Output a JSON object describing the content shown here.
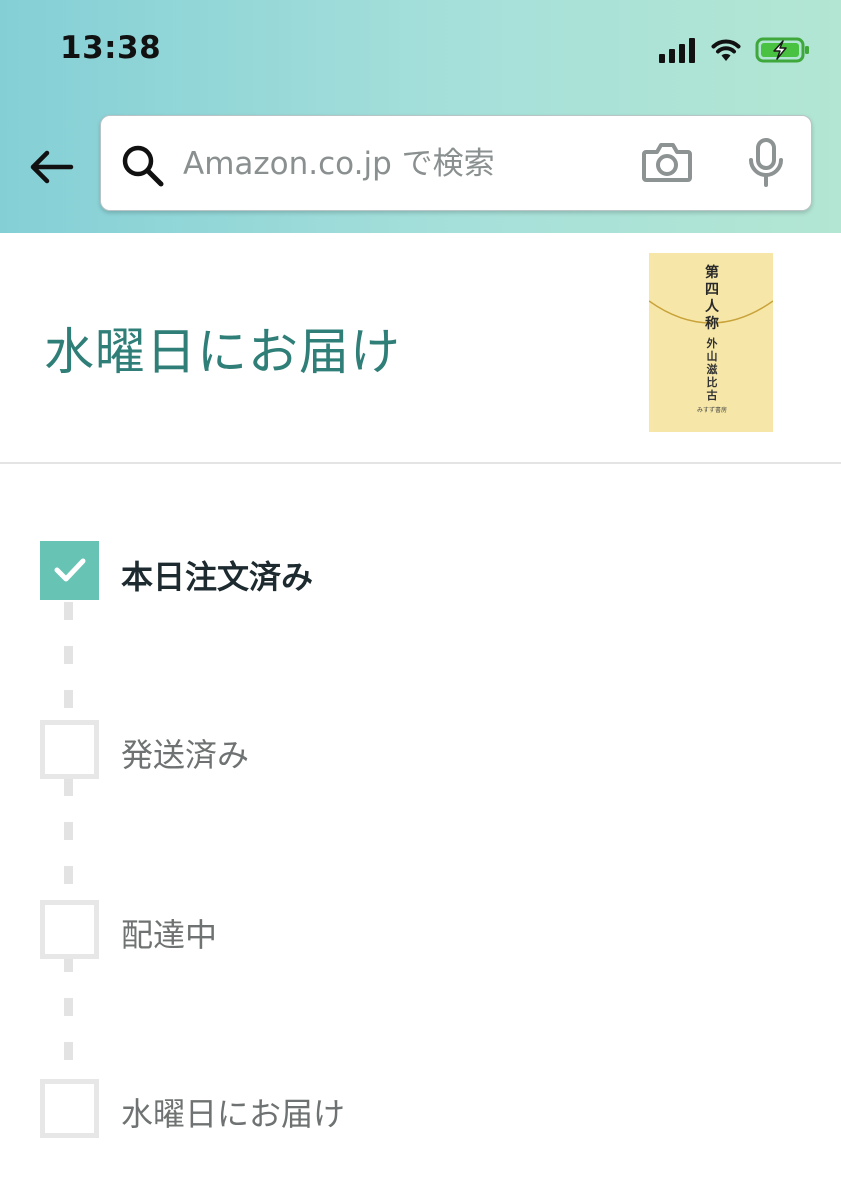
{
  "status_bar": {
    "time": "13:38"
  },
  "search": {
    "placeholder": "Amazon.co.jp で検索"
  },
  "delivery": {
    "title": "水曜日にお届け"
  },
  "product": {
    "cover_title": "第四人称",
    "cover_author": "外山滋比古",
    "cover_publisher": "みすず書房"
  },
  "tracker": {
    "steps": [
      {
        "label": "本日注文済み",
        "completed": true
      },
      {
        "label": "発送済み",
        "completed": false
      },
      {
        "label": "配達中",
        "completed": false
      },
      {
        "label": "水曜日にお届け",
        "completed": false
      }
    ]
  },
  "colors": {
    "accent": "#2f7f78",
    "check_fill": "#67c3b4",
    "header_gradient_start": "#84cfd6",
    "header_gradient_end": "#b3e6d3"
  },
  "icons": [
    "back-arrow-icon",
    "search-icon",
    "camera-icon",
    "microphone-icon",
    "signal-icon",
    "wifi-icon",
    "battery-charging-icon",
    "checkmark-icon"
  ]
}
